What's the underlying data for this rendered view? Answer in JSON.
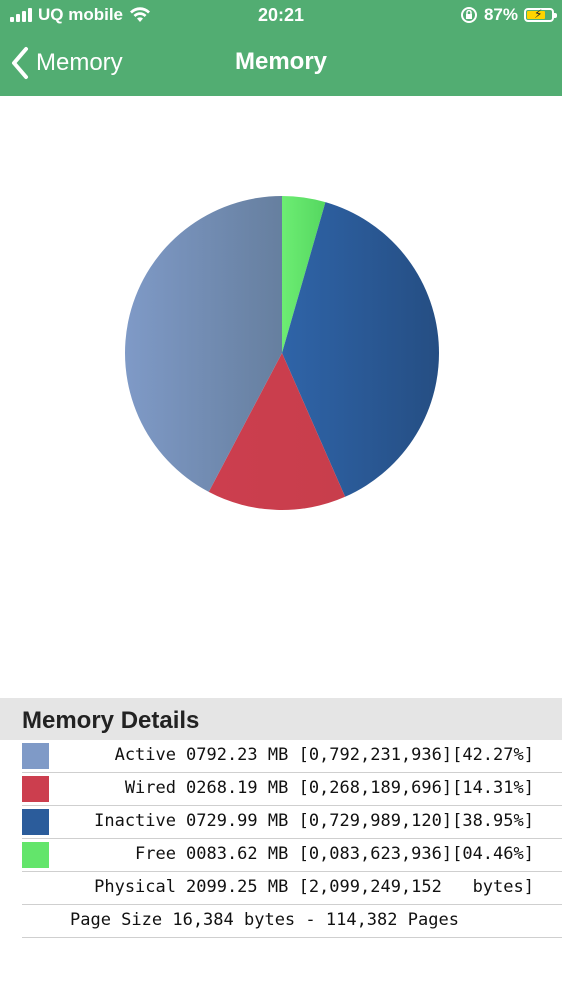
{
  "status_bar": {
    "carrier": "UQ mobile",
    "time": "20:21",
    "battery_percent": "87%",
    "icons": [
      "signal-icon",
      "wifi-icon",
      "rotation-lock-icon",
      "battery-charging-icon"
    ]
  },
  "nav": {
    "back_label": "Memory",
    "title": "Memory"
  },
  "colors": {
    "nav_green": "#52ad72",
    "active": "#7f9ac7",
    "wired": "#cc3e4e",
    "inactive": "#2b5c9b",
    "free": "#63e56b"
  },
  "chart_data": {
    "type": "pie",
    "slices": [
      {
        "label": "Free",
        "value": 4.46
      },
      {
        "label": "Inactive",
        "value": 38.95
      },
      {
        "label": "Wired",
        "value": 14.31
      },
      {
        "label": "Active",
        "value": 42.27
      }
    ],
    "start_angle": "12 o'clock",
    "direction": "clockwise"
  },
  "details": {
    "heading": "Memory Details",
    "rows": [
      {
        "label": "Active",
        "value": "0792.23 MB [0,792,231,936][42.27%]",
        "color": "#7f9ac7"
      },
      {
        "label": "Wired",
        "value": "0268.19 MB [0,268,189,696][14.31%]",
        "color": "#cc3e4e"
      },
      {
        "label": "Inactive",
        "value": "0729.99 MB [0,729,989,120][38.95%]",
        "color": "#2b5c9b"
      },
      {
        "label": "Free",
        "value": "0083.62 MB [0,083,623,936][04.46%]",
        "color": "#63e56b"
      }
    ],
    "physical_label": "Physical",
    "physical_value": "2099.25 MB [2,099,249,152   bytes]",
    "page_size_line": "Page Size 16,384 bytes - 114,382 Pages"
  }
}
